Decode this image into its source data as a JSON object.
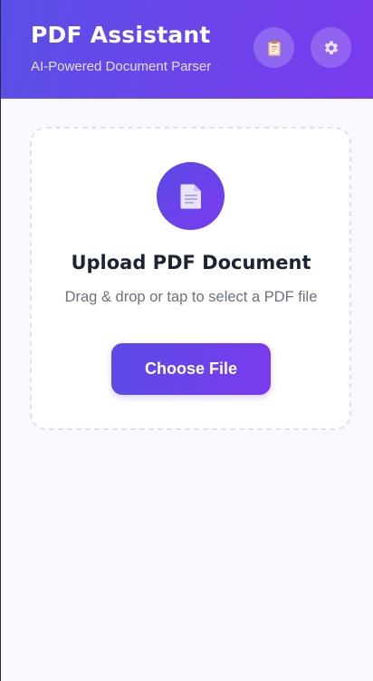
{
  "header": {
    "title": "PDF Assistant",
    "subtitle": "AI-Powered Document Parser",
    "buttons": [
      {
        "icon": "clipboard-icon"
      },
      {
        "icon": "gear-icon"
      }
    ]
  },
  "upload": {
    "icon": "document-icon",
    "title": "Upload PDF Document",
    "description": "Drag & drop or tap to select a PDF file",
    "button_label": "Choose File"
  },
  "colors": {
    "accent_start": "#5a4fe6",
    "accent_end": "#7a3bee",
    "background": "#f8f9fc",
    "title_text": "#1c2333",
    "muted_text": "#6b7280"
  }
}
